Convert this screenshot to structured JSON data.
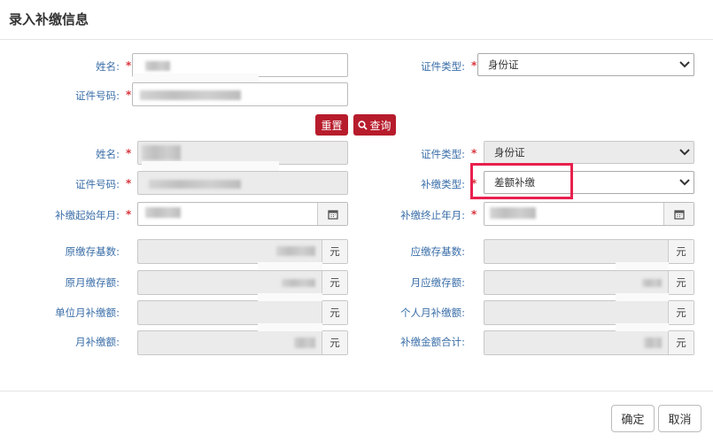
{
  "title": "录入补缴信息",
  "query": {
    "name_label": "姓名:",
    "idtype_label": "证件类型:",
    "idtype_value": "身份证",
    "idno_label": "证件号码:",
    "reset_label": "重置",
    "search_label": "查询",
    "required_mark": "*"
  },
  "detail": {
    "name_label": "姓名:",
    "idtype_label": "证件类型:",
    "idtype_value": "身份证",
    "idno_label": "证件号码:",
    "paytype_label": "补缴类型:",
    "paytype_value": "差额补缴",
    "start_label": "补缴起始年月:",
    "end_label": "补缴终止年月:",
    "orig_base_label": "原缴存基数:",
    "due_base_label": "应缴存基数:",
    "orig_month_label": "原月缴存额:",
    "due_month_label": "月应缴存额:",
    "unit_month_label": "单位月补缴额:",
    "person_month_label": "个人月补缴额:",
    "month_pay_label": "月补缴额:",
    "total_label": "补缴金额合计:",
    "unit": "元"
  },
  "footer": {
    "ok_label": "确定",
    "cancel_label": "取消"
  },
  "colors": {
    "accent": "#b71c2c",
    "label": "#3a6ea8",
    "highlight": "#e8204e"
  }
}
